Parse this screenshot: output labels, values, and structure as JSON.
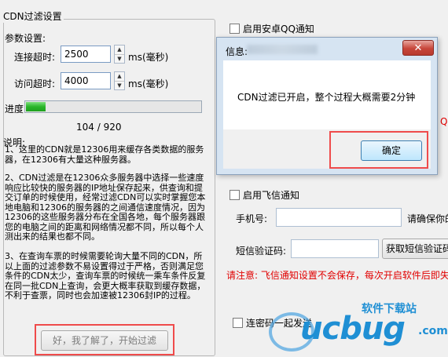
{
  "cdn": {
    "group_title": "CDN过滤设置",
    "params_label": "参数设置:",
    "connect_timeout_label": "连接超时:",
    "connect_timeout_value": "2500",
    "access_timeout_label": "访问超时:",
    "access_timeout_value": "4000",
    "unit_label": "ms(毫秒)",
    "progress_label": "进度",
    "progress_text": "104 / 920",
    "progress_fraction": 0.113,
    "description_title": "说明:",
    "para1": "1、这里的CDN就是12306用来缓存各类数据的服务器，在12306有大量这种服务器。",
    "para2": "2、CDN过滤是在12306众多服务器中选择一些速度响应比较快的服务器的IP地址保存起来，供查询和提交订单的时候使用，经常过滤CDN可以实时掌握您本地电脑和12306的服务器的之间通信速度情况，因为12306的这些服务器分布在全国各地，每个服务器跟您的电脑之间的距离和网络情况都不同，所以每个人测出来的结果也都不同。",
    "para3": "3、在查询车票的时候需要轮询大量不同的CDN，所以上面的过滤参数不易设置得过于严格，否则满足您条件的CDN太少，查询车票的时候统一乘车条件反复在同一批CDN上查询，会更大概率获取到缓存数据，不利于查票，同时也会加速被12306封IP的过程。",
    "start_button": "好，我了解了，开始过滤"
  },
  "right": {
    "android_qq": "启用安卓QQ通知",
    "feixin": "启用飞信通知",
    "phone_label": "手机号:",
    "phone_hint": "请确保你的",
    "sms_label": "短信验证码:",
    "get_sms_button": "获取短信验证码",
    "warning": "请注意: 飞信通知设置不会保存，每次开启软件后即失",
    "side_red": "Q",
    "bottom_checkbox": "连密码一起发送"
  },
  "dialog": {
    "title": "信息:",
    "close": "✕",
    "message": "CDN过滤已开启，整个过程大概需要2分钟",
    "ok_button": "确定"
  },
  "watermark": {
    "main": "ucbug",
    "top": "软件下载站",
    "com": ".com"
  },
  "colors": {
    "accent_red": "#ef4b4b",
    "progress_green": "#29b529",
    "watermark_blue": "#1f8fd4"
  }
}
